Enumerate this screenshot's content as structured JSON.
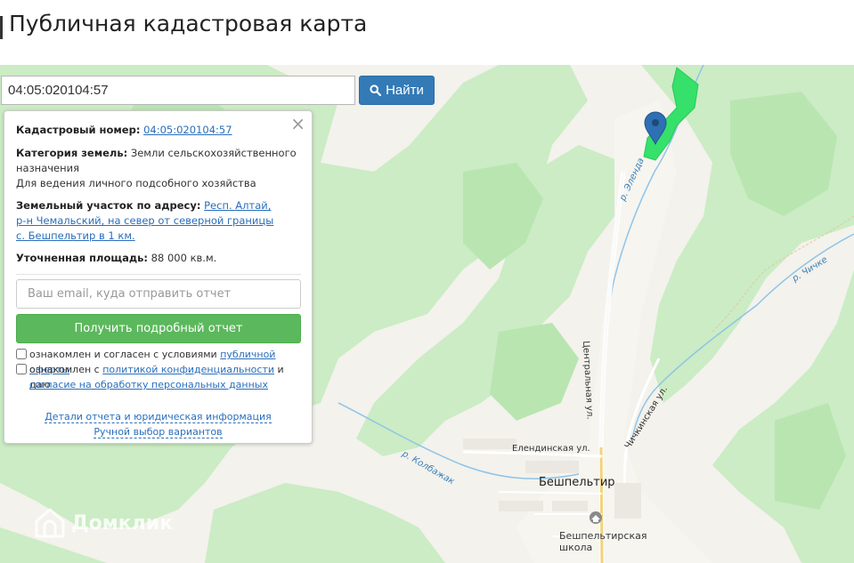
{
  "page": {
    "title": "Публичная кадастровая карта"
  },
  "search": {
    "value": "04:05:020104:57",
    "button_label": "Найти"
  },
  "popup": {
    "cadastral_label": "Кадастровый номер:",
    "cadastral_value": "04:05:020104:57",
    "category_label": "Категория земель:",
    "category_value": "Земли сельскохозяйственного назначения",
    "usage": "Для ведения личного подсобного хозяйства",
    "address_label": "Земельный участок по адресу:",
    "address_value": "Респ. Алтай, р-н Чемальский, на север от северной границы с. Бешпельтир в 1 км.",
    "area_label": "Уточненная площадь:",
    "area_value": "88 000 кв.м.",
    "email_placeholder": "Ваш email, куда отправить отчет",
    "report_button": "Получить подробный отчет",
    "consent1_prefix": "ознакомлен и согласен с условиями",
    "consent1_link": "публичной оферты",
    "consent2_prefix": "ознакомлен с",
    "consent2_link": "политикой конфиденциальности",
    "consent2_middle": "и даю",
    "consent2_link2": "согласие на обработку персональных данных",
    "link_details": "Детали отчета и юридическая информация",
    "link_manual": "Ручной выбор вариантов"
  },
  "map": {
    "labels": {
      "river_elenda": "р. Эленда",
      "river_chichke": "р. Чичке",
      "street_central": "Центральная ул.",
      "street_chichkinskaya": "Чичкинская ул.",
      "street_elendinskaya": "Елендинская ул.",
      "river_kolbazhak": "р. Колбажак",
      "village": "Бешпельтир",
      "school": "Бешпельтирская школа"
    },
    "watermark": "Домклик",
    "colors": {
      "parcel": "#35e06b",
      "marker": "#2f6fb3",
      "forest": "#c9ecc2",
      "meadow": "#f5f3ec"
    }
  }
}
